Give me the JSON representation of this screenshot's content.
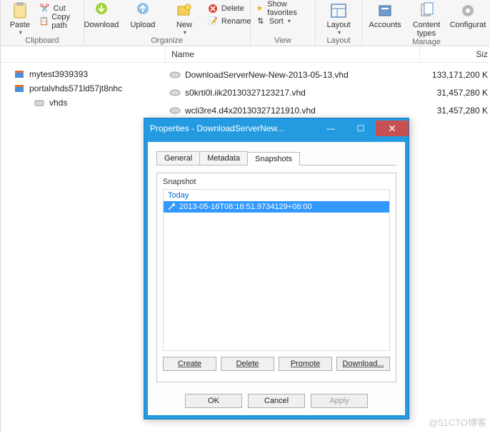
{
  "ribbon": {
    "clipboard": {
      "paste": "Paste",
      "cut": "Cut",
      "copy_path": "Copy path",
      "label": "Clipboard"
    },
    "organize": {
      "download": "Download",
      "upload": "Upload",
      "new": "New",
      "delete": "Delete",
      "rename": "Rename",
      "label": "Organize"
    },
    "view": {
      "favorites": "Show favorites",
      "sort": "Sort",
      "label": "View"
    },
    "layout": {
      "layout": "Layout",
      "label": "Layout"
    },
    "manage": {
      "accounts": "Accounts",
      "content_types": "Content\ntypes",
      "config": "Configurat",
      "label": "Manage"
    }
  },
  "columns": {
    "name": "Name",
    "size": "Siz"
  },
  "tree": {
    "items": [
      {
        "label": "mytest3939393"
      },
      {
        "label": "portalvhds571ld57jt8nhc"
      },
      {
        "label": "vhds"
      }
    ]
  },
  "files": [
    {
      "name": "DownloadServerNew-New-2013-05-13.vhd",
      "size": "133,171,200 K"
    },
    {
      "name": "s0krti0l.iik20130327123217.vhd",
      "size": "31,457,280 K"
    },
    {
      "name": "wcli3re4.d4x20130327121910.vhd",
      "size": "31,457,280 K"
    }
  ],
  "dialog": {
    "title": "Properties - DownloadServerNew...",
    "tabs": {
      "general": "General",
      "metadata": "Metadata",
      "snapshots": "Snapshots"
    },
    "snapbox_label": "Snapshot",
    "group_today": "Today",
    "snapshot_selected": "2013-05-16T08:18:51.9734129+08:00",
    "buttons": {
      "create": "Create",
      "delete": "Delete",
      "promote": "Promote",
      "download": "Download..."
    },
    "footer": {
      "ok": "OK",
      "cancel": "Cancel",
      "apply": "Apply"
    }
  },
  "watermark": "@51CTO博客"
}
